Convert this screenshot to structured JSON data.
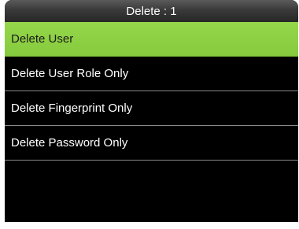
{
  "header": {
    "title": "Delete : 1"
  },
  "menu": {
    "items": [
      {
        "label": "Delete User",
        "selected": true
      },
      {
        "label": "Delete User Role Only",
        "selected": false
      },
      {
        "label": "Delete Fingerprint Only",
        "selected": false
      },
      {
        "label": "Delete Password Only",
        "selected": false
      }
    ]
  },
  "colors": {
    "background": "#000000",
    "selected_row": "#8fd144",
    "title_bar": "#3a3a3a",
    "text": "#ffffff",
    "divider": "#8a8a8a"
  }
}
